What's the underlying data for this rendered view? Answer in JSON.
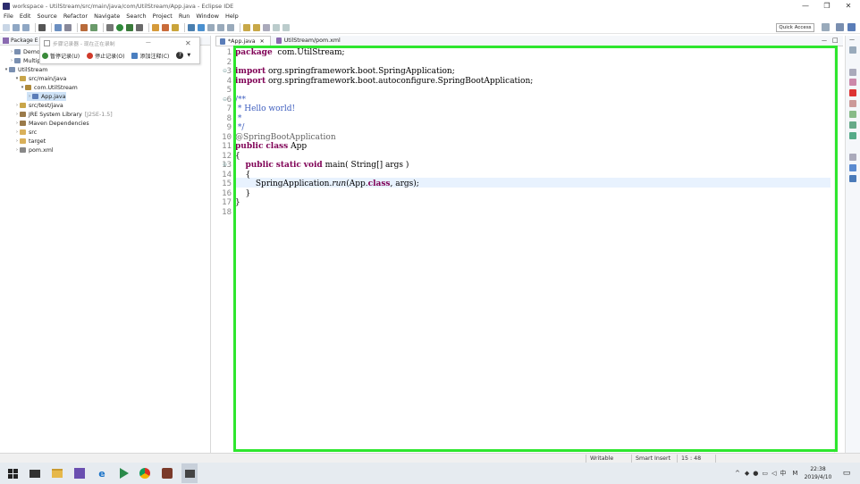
{
  "window": {
    "title": "workspace - UtilStream/src/main/java/com/UtilStream/App.java - Eclipse IDE",
    "minimize": "—",
    "maximize": "❐",
    "close": "✕"
  },
  "menu": [
    "File",
    "Edit",
    "Source",
    "Refactor",
    "Navigate",
    "Search",
    "Project",
    "Run",
    "Window",
    "Help"
  ],
  "toolbar": {
    "quick_access": "Quick Access"
  },
  "package_explorer": {
    "tab": "Package E",
    "items": [
      {
        "label": "Demo2",
        "icon": "project-icon"
      },
      {
        "label": "Multipl",
        "icon": "project-icon"
      },
      {
        "label": "UtilStream",
        "icon": "project-icon",
        "expanded": true
      },
      {
        "label": "src/main/java",
        "icon": "source-folder-icon",
        "expanded": true
      },
      {
        "label": "com.UtilStream",
        "icon": "package-icon",
        "expanded": true
      },
      {
        "label": "App.java",
        "icon": "java-file-icon",
        "selected": true
      },
      {
        "label": "src/test/java",
        "icon": "source-folder-icon"
      },
      {
        "label": "JRE System Library",
        "suffix": "[J2SE-1.5]",
        "icon": "library-icon"
      },
      {
        "label": "Maven Dependencies",
        "icon": "library-icon"
      },
      {
        "label": "src",
        "icon": "folder-icon"
      },
      {
        "label": "target",
        "icon": "folder-icon"
      },
      {
        "label": "pom.xml",
        "icon": "xml-file-icon"
      }
    ]
  },
  "recorder_popup": {
    "title": "步骤记录器 - 现在正在录制",
    "buttons": [
      "暂停记录(U)",
      "停止记录(O)",
      "添加注释(C)"
    ],
    "help": "?"
  },
  "editor": {
    "tabs": [
      {
        "label": "*App.java",
        "active": true
      },
      {
        "label": "UtilStream/pom.xml",
        "active": false
      }
    ],
    "current_line": 15,
    "lines": [
      {
        "n": "1",
        "tokens": [
          [
            "kw",
            "package"
          ],
          [
            "",
            "  com.UtilStream;"
          ]
        ]
      },
      {
        "n": "2",
        "tokens": []
      },
      {
        "n": "3",
        "fold": "⊖",
        "tokens": [
          [
            "kw",
            "import"
          ],
          [
            "",
            " org.springframework.boot.SpringApplication;"
          ]
        ]
      },
      {
        "n": "4",
        "tokens": [
          [
            "kw",
            "import"
          ],
          [
            "",
            " org.springframework.boot.autoconfigure.SpringBootApplication;"
          ]
        ]
      },
      {
        "n": "5",
        "tokens": []
      },
      {
        "n": "6",
        "fold": "⊖",
        "tokens": [
          [
            "cm",
            "/**"
          ]
        ]
      },
      {
        "n": "7",
        "tokens": [
          [
            "cm",
            " * Hello world!"
          ]
        ]
      },
      {
        "n": "8",
        "tokens": [
          [
            "cm",
            " *"
          ]
        ]
      },
      {
        "n": "9",
        "tokens": [
          [
            "cm",
            " */"
          ]
        ]
      },
      {
        "n": "10",
        "tokens": [
          [
            "an",
            "@SpringBootApplication"
          ]
        ]
      },
      {
        "n": "11",
        "tokens": [
          [
            "kw",
            "public"
          ],
          [
            "",
            " "
          ],
          [
            "kw",
            "class"
          ],
          [
            "",
            " App"
          ]
        ]
      },
      {
        "n": "12",
        "tokens": [
          [
            "",
            "{"
          ]
        ]
      },
      {
        "n": "13",
        "fold": "⊖",
        "tokens": [
          [
            "",
            "    "
          ],
          [
            "kw",
            "public"
          ],
          [
            "",
            " "
          ],
          [
            "kw",
            "static"
          ],
          [
            "",
            " "
          ],
          [
            "kw",
            "void"
          ],
          [
            "",
            " main( String[] args )"
          ]
        ]
      },
      {
        "n": "14",
        "tokens": [
          [
            "",
            "    {"
          ]
        ]
      },
      {
        "n": "15",
        "tokens": [
          [
            "",
            "        SpringApplication."
          ],
          [
            "it",
            "run"
          ],
          [
            "",
            "(App."
          ],
          [
            "kw",
            "class"
          ],
          [
            "",
            ", args);"
          ]
        ]
      },
      {
        "n": "16",
        "tokens": [
          [
            "",
            "    }"
          ]
        ]
      },
      {
        "n": "17",
        "tokens": [
          [
            "",
            "}"
          ]
        ]
      },
      {
        "n": "18",
        "tokens": []
      }
    ]
  },
  "status_bar": {
    "mode": "Writable",
    "insert": "Smart Insert",
    "position": "15 : 48"
  },
  "taskbar": {
    "time": "22:38",
    "date": "2019/4/10",
    "ime": "中",
    "ime2": "M"
  },
  "colors": {
    "highlight_box": "#2ee62e",
    "keyword": "#7f0055",
    "comment": "#3f5fbf",
    "annotation": "#646464"
  }
}
